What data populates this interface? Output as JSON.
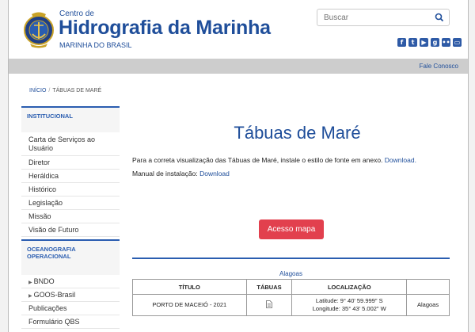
{
  "header": {
    "top_line": "Centro de",
    "title": "Hidrografia da Marinha",
    "subtitle": "MARINHA DO BRASIL",
    "search_placeholder": "Buscar",
    "social_icons": [
      "facebook-icon",
      "twitter-icon",
      "youtube-icon",
      "google-plus-icon",
      "flickr-icon",
      "devices-icon"
    ],
    "brand_color": "#1f4e9a"
  },
  "topbar": {
    "contact": "Fale Conosco"
  },
  "breadcrumb": {
    "home": "INÍCIO",
    "separator": "/",
    "current": "TÁBUAS DE MARÉ"
  },
  "sidebar": {
    "sections": [
      {
        "title": "INSTITUCIONAL"
      },
      {
        "title": "OCEANOGRAFIA OPERACIONAL"
      }
    ],
    "institucional": [
      "Carta de Serviços ao Usuário",
      "Diretor",
      "Heráldica",
      "Histórico",
      "Legislação",
      "Missão",
      "Visão de Futuro"
    ],
    "oceanografia": [
      "BNDO",
      "GOOS-Brasil",
      "Publicações",
      "Formulário QBS"
    ]
  },
  "content": {
    "title": "Tábuas de Maré",
    "paragraph": "Para a correta visualização das Tábuas de Maré, instale o estilo de fonte em anexo.",
    "paragraph_link": "Download.",
    "manual_label": "Manual de instalação:",
    "manual_link": "Download",
    "map_button": "Acesso mapa",
    "button_color": "#e2404e"
  },
  "table": {
    "region": "Alagoas",
    "headers": [
      "TÍTULO",
      "TÁBUAS",
      "LOCALIZAÇÃO",
      ""
    ],
    "rows": [
      {
        "titulo": "PORTO DE MACEIÓ - 2021",
        "tabuas_icon": "document-icon",
        "latitude": "Latitude: 9° 40' 59.999\" S",
        "longitude": "Longitude: 35° 43' 5.002\" W",
        "estado": "Alagoas"
      }
    ]
  }
}
